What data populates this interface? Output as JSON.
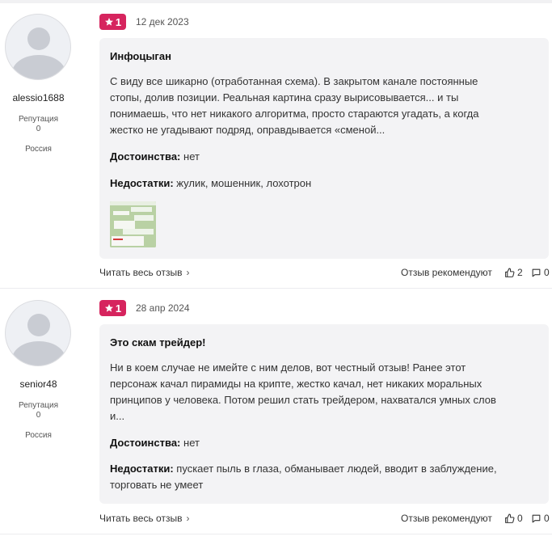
{
  "reviews": [
    {
      "user": {
        "name": "alessio1688",
        "reputation_label": "Репутация",
        "reputation": "0",
        "country": "Россия"
      },
      "rating": "1",
      "date": "12 дек 2023",
      "title": "Инфоцыган",
      "text_lines": [
        "С виду все шикарно (отработанная схема). В закрытом канале постоянные",
        "стопы, долив позиции. Реальная картина сразу вырисовывается... и ты",
        "понимаешь, что нет никакого алгоритма, просто стараются угадать, а когда",
        "жестко не угадывают подряд, оправдывается «сменой..."
      ],
      "pros_label": "Достоинства:",
      "pros": "нет",
      "cons_label": "Недостатки:",
      "cons_lines": [
        "жулик, мошенник, лохотрон"
      ],
      "read_more": "Читать весь отзыв",
      "recommend_label": "Отзыв рекомендуют",
      "likes": "2",
      "comments": "0"
    },
    {
      "user": {
        "name": "senior48",
        "reputation_label": "Репутация",
        "reputation": "0",
        "country": "Россия"
      },
      "rating": "1",
      "date": "28 апр 2024",
      "title": "Это скам трейдер!",
      "text_lines": [
        "Ни в коем случае не имейте с ним делов, вот честный отзыв! Ранее этот",
        "персонаж качал пирамиды на крипте, жестко качал, нет никаких моральных",
        "принципов у человека. Потом решил стать трейдером, нахватался умных слов",
        "и..."
      ],
      "pros_label": "Достоинства:",
      "pros": "нет",
      "cons_label": "Недостатки:",
      "cons_lines": [
        "пускает пыль в глаза, обманывает людей, вводит в заблуждение,",
        "торговать не умеет"
      ],
      "read_more": "Читать весь отзыв",
      "recommend_label": "Отзыв рекомендуют",
      "likes": "0",
      "comments": "0"
    }
  ],
  "colors": {
    "rating_badge": "#d6245e",
    "card_bg": "#f3f3f5"
  },
  "icons": [
    "star-icon",
    "thumbs-up-icon",
    "comment-icon",
    "chevron-right-icon",
    "default-avatar-icon"
  ]
}
